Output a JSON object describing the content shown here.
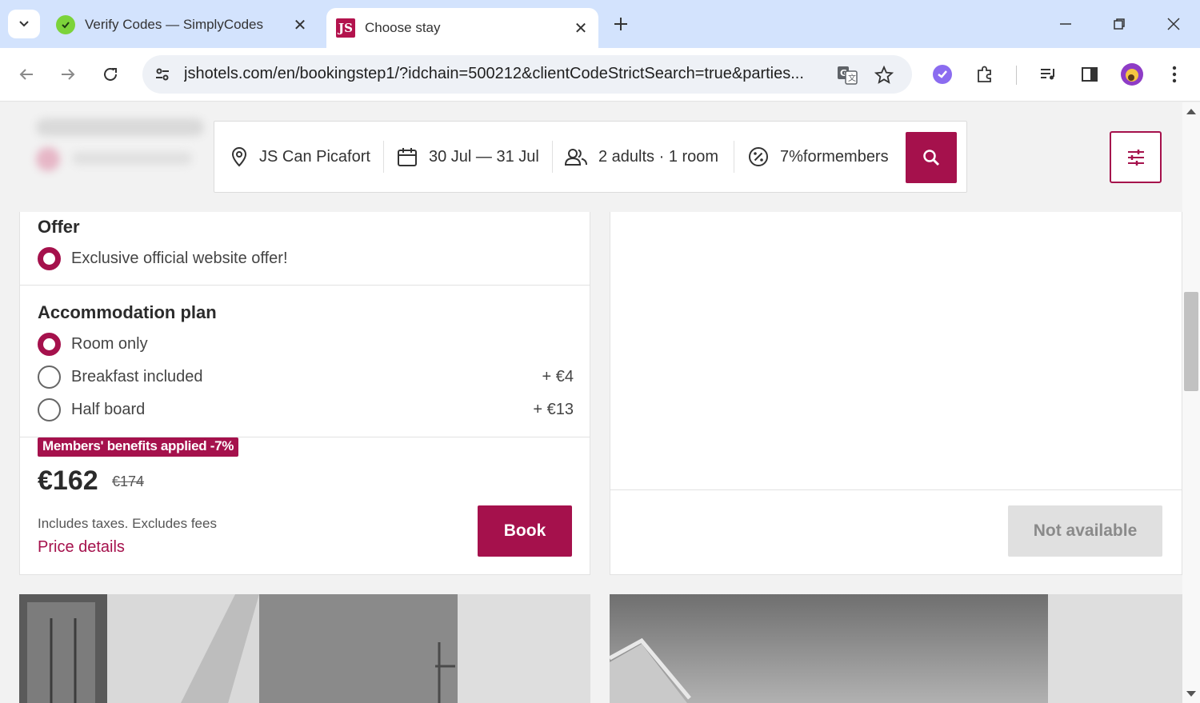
{
  "browser": {
    "tabs": [
      {
        "title": "Verify Codes — SimplyCodes",
        "active": false
      },
      {
        "title": "Choose stay",
        "active": true
      }
    ],
    "url": "jshotels.com/en/bookingstep1/?idchain=500212&clientCodeStrictSearch=true&parties...",
    "favicon_js_text": "JS"
  },
  "search": {
    "location": "JS Can Picafort",
    "dates": "30 Jul — 31 Jul",
    "guests": "2 adults · 1 room",
    "promo": "7%formembers"
  },
  "offer": {
    "title": "Offer",
    "option": "Exclusive official website offer!"
  },
  "accommodation": {
    "title": "Accommodation plan",
    "options": [
      {
        "label": "Room only",
        "extra": "",
        "checked": true
      },
      {
        "label": "Breakfast included",
        "extra": "+ €4",
        "checked": false
      },
      {
        "label": "Half board",
        "extra": "+ €13",
        "checked": false
      }
    ]
  },
  "pricing": {
    "badge": "Members' benefits applied -7%",
    "price": "€162",
    "old_price": "€174",
    "taxes_note": "Includes taxes. Excludes fees",
    "details_link": "Price details",
    "book_label": "Book"
  },
  "right_card": {
    "button_label": "Not available"
  },
  "colors": {
    "brand": "#a5114c",
    "tabstrip": "#d3e3fd"
  }
}
